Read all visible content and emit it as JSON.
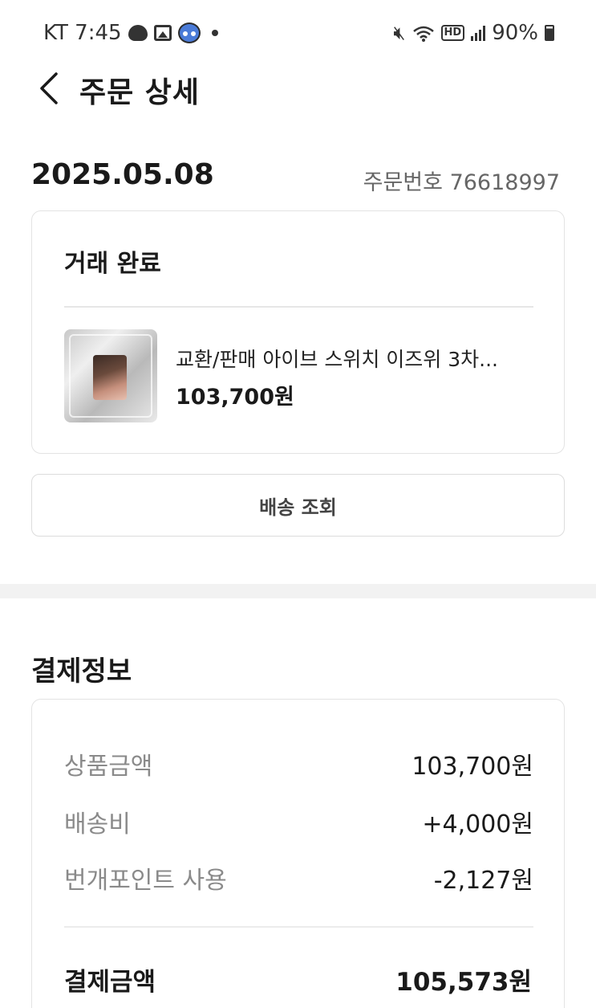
{
  "status_bar": {
    "carrier_time": "KT 7:45",
    "battery": "90%"
  },
  "header": {
    "title": "주문 상세"
  },
  "order": {
    "date": "2025.05.08",
    "number_label": "주문번호 76618997",
    "status": "거래 완료",
    "product": {
      "name": "교환/판매 아이브 스위치 이즈위 3차...",
      "price": "103,700원"
    },
    "delivery_button": "배송 조회"
  },
  "payment": {
    "title": "결제정보",
    "rows": [
      {
        "label": "상품금액",
        "value": "103,700원"
      },
      {
        "label": "배송비",
        "value": "+4,000원"
      },
      {
        "label": "번개포인트 사용",
        "value": "-2,127원"
      }
    ],
    "total_label": "결제금액",
    "total_value": "105,573원"
  },
  "colors": {
    "text_primary": "#1a1a1a",
    "text_secondary": "#8a8a8a",
    "border": "#e3e3e3",
    "section_gap": "#f2f2f2"
  },
  "icons": [
    "back-icon",
    "mute-icon",
    "wifi-icon",
    "hd-icon",
    "signal-icon",
    "battery-icon"
  ]
}
